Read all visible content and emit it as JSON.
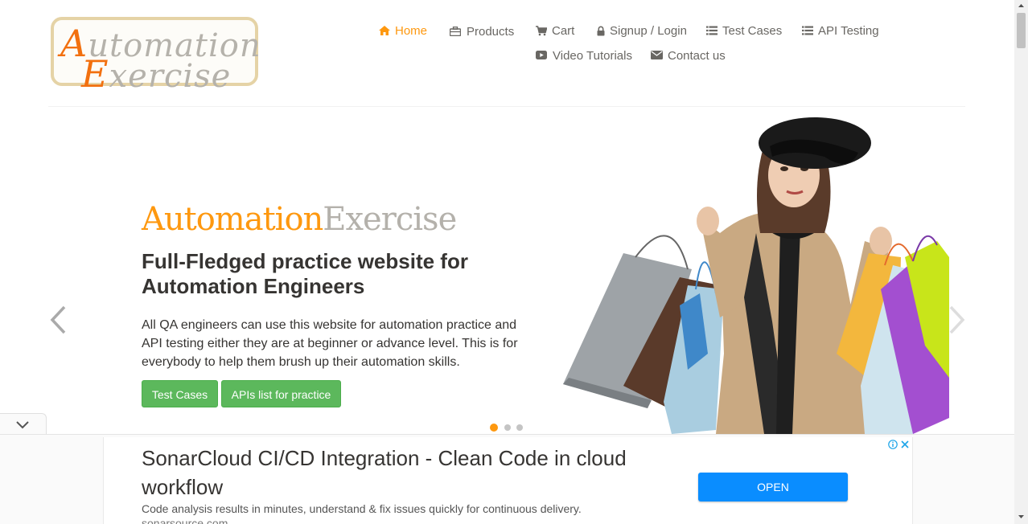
{
  "logo": {
    "line1_cap": "A",
    "line1_rest": "utomation",
    "line2_cap": "E",
    "line2_rest": "xercise",
    "colors": {
      "accent": "#f2700f",
      "text": "#b5b2ab",
      "border": "#e5d3a6"
    }
  },
  "nav": {
    "home": {
      "label": "Home",
      "icon": "home-icon"
    },
    "products": {
      "label": "Products",
      "icon": "briefcase-icon"
    },
    "cart": {
      "label": "Cart",
      "icon": "shopping-cart-icon"
    },
    "signup_login": {
      "label": "Signup / Login",
      "icon": "lock-icon"
    },
    "test_cases": {
      "label": "Test Cases",
      "icon": "list-icon"
    },
    "api_testing": {
      "label": "API Testing",
      "icon": "list-icon"
    },
    "video_tutorials": {
      "label": "Video Tutorials",
      "icon": "youtube-play-icon"
    },
    "contact_us": {
      "label": "Contact us",
      "icon": "envelope-icon"
    }
  },
  "slider": {
    "brand_part1": "Automation",
    "brand_part2": "Exercise",
    "headline": "Full-Fledged practice website for Automation Engineers",
    "description": "All QA engineers can use this website for automation practice and API testing either they are at beginner or advance level. This is for everybody to help them brush up their automation skills.",
    "buttons": {
      "test_cases": "Test Cases",
      "apis_list": "APIs list for practice"
    },
    "active_slide": 1,
    "slide_count": 3,
    "colors": {
      "accent": "#fe980f",
      "button": "#5cb85c"
    }
  },
  "ad": {
    "title": "SonarCloud CI/CD Integration - Clean Code in cloud workflow",
    "description": "Code analysis results in minutes, understand & fix issues quickly for continuous delivery.",
    "url": "sonarsource.com",
    "cta": "OPEN",
    "cta_color": "#0a8dff"
  }
}
